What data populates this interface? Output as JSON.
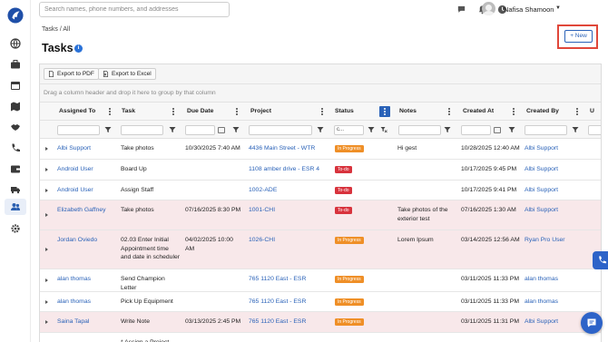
{
  "colors": {
    "accent": "#2a62b8",
    "todo": "#d8333d",
    "in_progress": "#ef8f27",
    "highlight_box": "#e0473a",
    "row_highlight": "#f8e8ea"
  },
  "topbar": {
    "search_placeholder": "Search names, phone numbers, and addresses",
    "icons": [
      "chat-icon",
      "bell-icon",
      "clock-icon"
    ],
    "user_name": "Nafisa Shamoon"
  },
  "sidebar": {
    "icons": [
      "globe-icon",
      "briefcase-icon",
      "calendar-icon",
      "map-icon",
      "handshake-icon",
      "phone-icon",
      "wallet-icon",
      "truck-icon",
      "users-icon",
      "gear-icon"
    ],
    "active": "users-icon"
  },
  "breadcrumb": "Tasks / All",
  "page": {
    "title": "Tasks",
    "new_button": "+ New"
  },
  "toolbar": {
    "export_pdf": "Export to PDF",
    "export_excel": "Export to Excel"
  },
  "group_panel": "Drag a column header and drop it here to group by that column",
  "grid": {
    "columns": [
      "Assigned To",
      "Task",
      "Due Date",
      "Project",
      "Status",
      "Notes",
      "Created At",
      "Created By",
      "U"
    ],
    "status_filter_value": "c...",
    "rows": [
      {
        "assigned_to": "Albi Support",
        "task": "Take photos",
        "due_date": "10/30/2025 7:40 AM",
        "project": "4436 Main Street - WTR",
        "status": "In Progress",
        "notes": "Hi gest",
        "created_at": "10/28/2025 12:40 AM",
        "created_by": "Albi Support",
        "highlight": false
      },
      {
        "assigned_to": "Android User",
        "task": "Board Up",
        "due_date": "",
        "project": "1108 amber drive - ESR 4",
        "status": "To-do",
        "notes": "",
        "created_at": "10/17/2025 9:45 PM",
        "created_by": "Albi Support",
        "highlight": false
      },
      {
        "assigned_to": "Android User",
        "task": "Assign Staff",
        "due_date": "",
        "project": "1002-ADE",
        "status": "To-do",
        "notes": "",
        "created_at": "10/17/2025 9:41 PM",
        "created_by": "Albi Support",
        "highlight": false
      },
      {
        "assigned_to": "Elizabeth Gaffney",
        "task": "Take photos",
        "due_date": "07/16/2025 8:30 PM",
        "project": "1001-CHI",
        "status": "To-do",
        "notes": "Take photos of the exterior test",
        "created_at": "07/16/2025 1:30 AM",
        "created_by": "Albi Support",
        "highlight": true
      },
      {
        "assigned_to": "Jordan Oviedo",
        "task": "02.03 Enter Initial Appointment time and date in scheduler",
        "due_date": "04/02/2025 10:00 AM",
        "project": "1026-CHI",
        "status": "In Progress",
        "notes": "Lorem Ipsum",
        "created_at": "03/14/2025 12:56 AM",
        "created_by": "Ryan Pro User",
        "highlight": true
      },
      {
        "assigned_to": "alan thomas",
        "task": "Send Champion Letter",
        "due_date": "",
        "project": "765 1120 East - ESR",
        "status": "In Progress",
        "notes": "",
        "created_at": "03/11/2025 11:33 PM",
        "created_by": "alan thomas",
        "highlight": false
      },
      {
        "assigned_to": "alan thomas",
        "task": "Pick Up Equipment",
        "due_date": "",
        "project": "765 1120 East - ESR",
        "status": "In Progress",
        "notes": "",
        "created_at": "03/11/2025 11:33 PM",
        "created_by": "alan thomas",
        "highlight": false
      },
      {
        "assigned_to": "Saina Tapal",
        "task": "Write Note",
        "due_date": "03/13/2025 2:45 PM",
        "project": "765 1120 East - ESR",
        "status": "In Progress",
        "notes": "",
        "created_at": "03/11/2025 11:31 PM",
        "created_by": "Albi Support",
        "highlight": true
      },
      {
        "assigned_to": "",
        "task": "* Assign a Project",
        "due_date": "",
        "project": "",
        "status": "",
        "notes": "",
        "created_at": "",
        "created_by": "",
        "highlight": false
      }
    ]
  }
}
